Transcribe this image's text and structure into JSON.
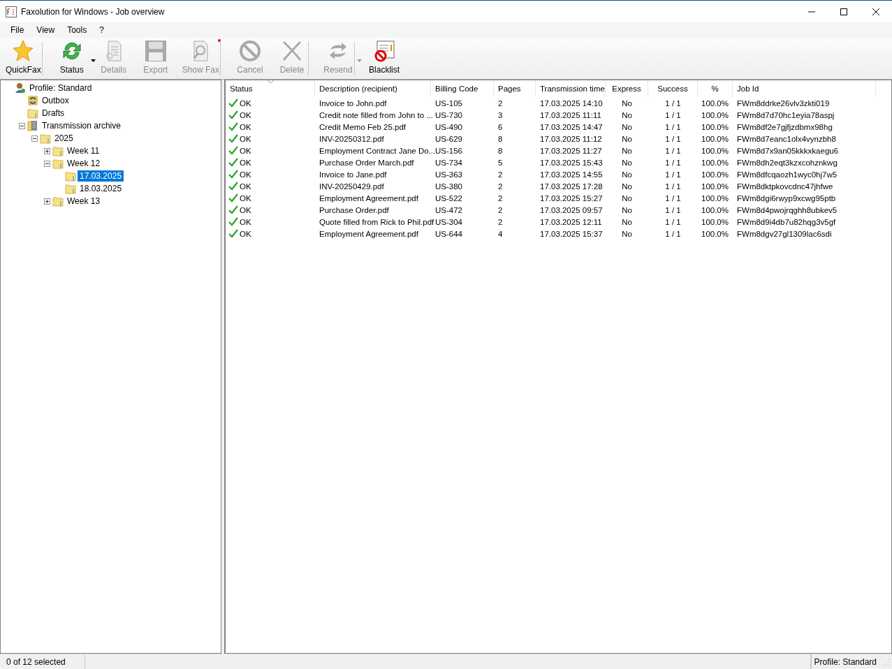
{
  "window": {
    "title": "Faxolution for Windows - Job overview"
  },
  "menu": [
    "File",
    "View",
    "Tools",
    "?"
  ],
  "toolbar": [
    {
      "kind": "quickfax",
      "label": "QuickFax",
      "disabled": false,
      "dropdown": false,
      "separator_after": true
    },
    {
      "kind": "status",
      "label": "Status",
      "disabled": false,
      "dropdown": true,
      "separator_after": false
    },
    {
      "kind": "details",
      "label": "Details",
      "disabled": true,
      "dropdown": false,
      "separator_after": false
    },
    {
      "kind": "export",
      "label": "Export",
      "disabled": true,
      "dropdown": false,
      "separator_after": false
    },
    {
      "kind": "showfax",
      "label": "Show Fax",
      "disabled": true,
      "dropdown": false,
      "separator_after": true
    },
    {
      "kind": "cancel",
      "label": "Cancel",
      "disabled": true,
      "dropdown": false,
      "separator_after": false
    },
    {
      "kind": "delete",
      "label": "Delete",
      "disabled": true,
      "dropdown": false,
      "separator_after": true
    },
    {
      "kind": "resend",
      "label": "Resend",
      "disabled": true,
      "dropdown": true,
      "separator_after": true
    },
    {
      "kind": "blacklist",
      "label": "Blacklist",
      "disabled": false,
      "dropdown": false,
      "separator_after": false
    }
  ],
  "tree": [
    {
      "kind": "profile",
      "label": "Profile: Standard",
      "selected": false,
      "children": [
        {
          "kind": "outbox",
          "label": "Outbox",
          "selected": false
        },
        {
          "kind": "drafts",
          "label": "Drafts",
          "selected": false
        },
        {
          "kind": "archive",
          "label": "Transmission archive",
          "selected": false,
          "expanded": true,
          "children": [
            {
              "kind": "folder",
              "label": "2025",
              "selected": false,
              "expanded": true,
              "children": [
                {
                  "kind": "folder",
                  "label": "Week 11",
                  "selected": false,
                  "expanded": false
                },
                {
                  "kind": "folder",
                  "label": "Week 12",
                  "selected": false,
                  "expanded": true,
                  "children": [
                    {
                      "kind": "folder",
                      "label": "17.03.2025",
                      "selected": true
                    },
                    {
                      "kind": "folder",
                      "label": "18.03.2025",
                      "selected": false
                    }
                  ]
                },
                {
                  "kind": "folder",
                  "label": "Week 13",
                  "selected": false,
                  "expanded": false
                }
              ]
            }
          ]
        }
      ]
    }
  ],
  "table": {
    "columns": [
      "Status",
      "Description (recipient)",
      "Billing Code",
      "Pages",
      "Transmission time",
      "Express",
      "Success",
      "%",
      "Job Id"
    ],
    "rows": [
      [
        "OK",
        "Invoice to John.pdf",
        "US-105",
        "2",
        "17.03.2025 14:10",
        "No",
        "1 / 1",
        "100.0%",
        "FWm8ddrke26vlv3zkti019"
      ],
      [
        "OK",
        "Credit note filled from John to ...",
        "US-730",
        "3",
        "17.03.2025 11:11",
        "No",
        "1 / 1",
        "100.0%",
        "FWm8d7d70hc1eyia78aspj"
      ],
      [
        "OK",
        "Credit Memo Feb 25.pdf",
        "US-490",
        "6",
        "17.03.2025 14:47",
        "No",
        "1 / 1",
        "100.0%",
        "FWm8df2e7gjfjzdbmx98hg"
      ],
      [
        "OK",
        "INV-20250312.pdf",
        "US-629",
        "8",
        "17.03.2025 11:12",
        "No",
        "1 / 1",
        "100.0%",
        "FWm8d7eanc1olx4vynzbh8"
      ],
      [
        "OK",
        "Employment Contract Jane Do...",
        "US-156",
        "8",
        "17.03.2025 11:27",
        "No",
        "1 / 1",
        "100.0%",
        "FWm8d7x9an05kkkxkaegu6"
      ],
      [
        "OK",
        "Purchase Order March.pdf",
        "US-734",
        "5",
        "17.03.2025 15:43",
        "No",
        "1 / 1",
        "100.0%",
        "FWm8dh2eqt3kzxcohznkwg"
      ],
      [
        "OK",
        "Invoice to Jane.pdf",
        "US-363",
        "2",
        "17.03.2025 14:55",
        "No",
        "1 / 1",
        "100.0%",
        "FWm8dfcqaozh1wyc0hj7w5"
      ],
      [
        "OK",
        "INV-20250429.pdf",
        "US-380",
        "2",
        "17.03.2025 17:28",
        "No",
        "1 / 1",
        "100.0%",
        "FWm8dktpkovcdnc47jhfwe"
      ],
      [
        "OK",
        "Employment Agreement.pdf",
        "US-522",
        "2",
        "17.03.2025 15:27",
        "No",
        "1 / 1",
        "100.0%",
        "FWm8dgi6rwyp9xcwg95ptb"
      ],
      [
        "OK",
        "Purchase Order.pdf",
        "US-472",
        "2",
        "17.03.2025 09:57",
        "No",
        "1 / 1",
        "100.0%",
        "FWm8d4pwojrqghh8ubkev5"
      ],
      [
        "OK",
        "Quote filled from Rick to Phil.pdf",
        "US-304",
        "2",
        "17.03.2025 12:11",
        "No",
        "1 / 1",
        "100.0%",
        "FWm8d9i4db7u82hqg3v5gf"
      ],
      [
        "OK",
        "Employment Agreement.pdf",
        "US-644",
        "4",
        "17.03.2025 15:37",
        "No",
        "1 / 1",
        "100.0%",
        "FWm8dgv27gl1309lac6sdi"
      ]
    ]
  },
  "status_bar": {
    "selection": "0 of 12 selected",
    "profile": "Profile: Standard"
  }
}
